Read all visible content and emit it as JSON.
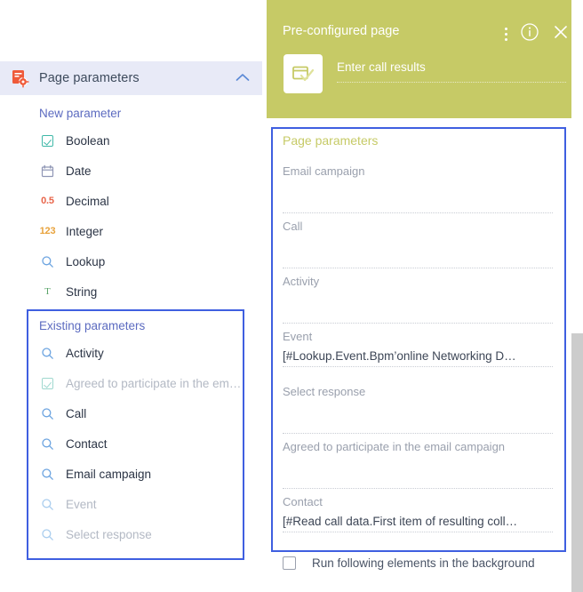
{
  "left_panel": {
    "header": {
      "title": "Page parameters",
      "icon": "page-settings-icon",
      "collapse_icon": "chevron-up-icon",
      "background": "#e8eaf7"
    },
    "new_parameter_label": "New parameter",
    "new_parameter_types": [
      {
        "label": "Boolean",
        "icon": "checkbox-icon",
        "glyph": "",
        "disabled": false
      },
      {
        "label": "Date",
        "icon": "calendar-icon",
        "glyph": "",
        "disabled": false
      },
      {
        "label": "Decimal",
        "icon": "decimal-icon",
        "glyph": "0.5",
        "disabled": false
      },
      {
        "label": "Integer",
        "icon": "integer-icon",
        "glyph": "123",
        "disabled": false
      },
      {
        "label": "Lookup",
        "icon": "magnifier-icon",
        "glyph": "",
        "disabled": false
      },
      {
        "label": "String",
        "icon": "string-icon",
        "glyph": "T",
        "disabled": false
      }
    ],
    "existing_parameters_label": "Existing parameters",
    "existing_parameters": [
      {
        "label": "Activity",
        "icon": "magnifier-icon",
        "disabled": false
      },
      {
        "label": "Agreed to participate in the em…",
        "icon": "checkbox-icon",
        "disabled": true
      },
      {
        "label": "Call",
        "icon": "magnifier-icon",
        "disabled": false
      },
      {
        "label": "Contact",
        "icon": "magnifier-icon",
        "disabled": false
      },
      {
        "label": "Email campaign",
        "icon": "magnifier-icon",
        "disabled": false
      },
      {
        "label": "Event",
        "icon": "magnifier-icon",
        "disabled": true
      },
      {
        "label": "Select response",
        "icon": "magnifier-icon",
        "disabled": true
      }
    ]
  },
  "right_panel": {
    "header": {
      "title": "Pre-configured page",
      "element_name": "Enter call results",
      "tile_icon": "page-check-icon",
      "menu_icon": "more-vertical-icon",
      "info_icon": "info-circle-icon",
      "close_icon": "close-icon",
      "background": "#c6ca66"
    },
    "form_title": "Page parameters",
    "fields": [
      {
        "label": "Email campaign",
        "value": ""
      },
      {
        "label": "Call",
        "value": ""
      },
      {
        "label": "Activity",
        "value": ""
      },
      {
        "label": "Event",
        "value": "[#Lookup.Event.Bpm’online Networking D…"
      },
      {
        "label": "Select response",
        "value": ""
      },
      {
        "label": "Agreed to participate in the email campaign",
        "value": ""
      },
      {
        "label": "Contact",
        "value": "[#Read call data.First item of resulting coll…"
      }
    ],
    "background_checkbox": {
      "label": "Run following elements in the background",
      "checked": false
    }
  },
  "highlight_color": "#3f5fe0"
}
